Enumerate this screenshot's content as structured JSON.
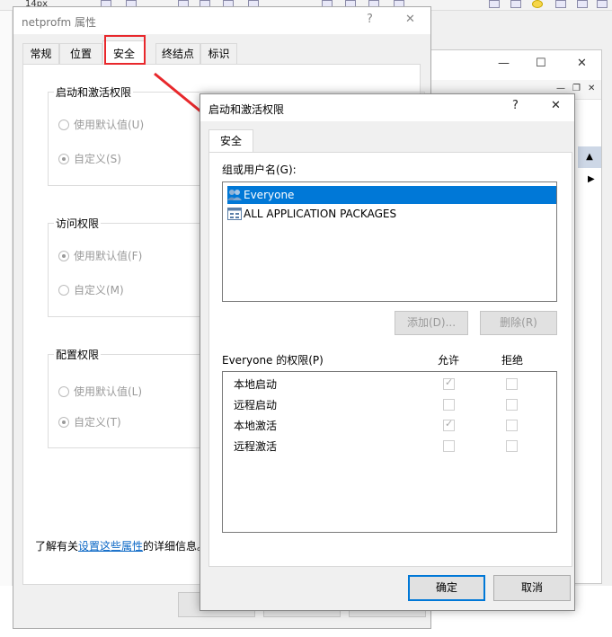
{
  "background": {
    "toolbar_font_size": "14px"
  },
  "props_dialog": {
    "title": "netprofm 属性",
    "help_glyph": "?",
    "close_glyph": "✕",
    "tabs": [
      "常规",
      "位置",
      "安全",
      "终结点",
      "标识"
    ],
    "groups": [
      {
        "label": "启动和激活权限",
        "opt_default": "使用默认值(U)",
        "opt_custom": "自定义(S)"
      },
      {
        "label": "访问权限",
        "opt_default": "使用默认值(F)",
        "opt_custom": "自定义(M)"
      },
      {
        "label": "配置权限",
        "opt_default": "使用默认值(L)",
        "opt_custom": "自定义(T)"
      }
    ],
    "learn_prefix": "了解有关",
    "learn_link": "设置这些属性",
    "learn_suffix": "的详细信息。"
  },
  "perm_dialog": {
    "title": "启动和激活权限",
    "help_glyph": "?",
    "close_glyph": "✕",
    "tab": "安全",
    "users_label": "组或用户名(G):",
    "users": [
      {
        "name": "Everyone",
        "selected": true,
        "icon": "users-group-icon"
      },
      {
        "name": "ALL APPLICATION PACKAGES",
        "selected": false,
        "icon": "app-packages-icon"
      }
    ],
    "add_button": "添加(D)...",
    "remove_button": "删除(R)",
    "perms_label": "Everyone 的权限(P)",
    "allow_header": "允许",
    "deny_header": "拒绝",
    "permissions": [
      {
        "name": "本地启动",
        "allow": true,
        "deny": false
      },
      {
        "name": "远程启动",
        "allow": false,
        "deny": false
      },
      {
        "name": "本地激活",
        "allow": true,
        "deny": false
      },
      {
        "name": "远程激活",
        "allow": false,
        "deny": false
      }
    ],
    "ok_button": "确定",
    "cancel_button": "取消"
  },
  "colors": {
    "highlight": "#e8282c",
    "selection": "#0078d7",
    "link": "#0a67c6"
  }
}
